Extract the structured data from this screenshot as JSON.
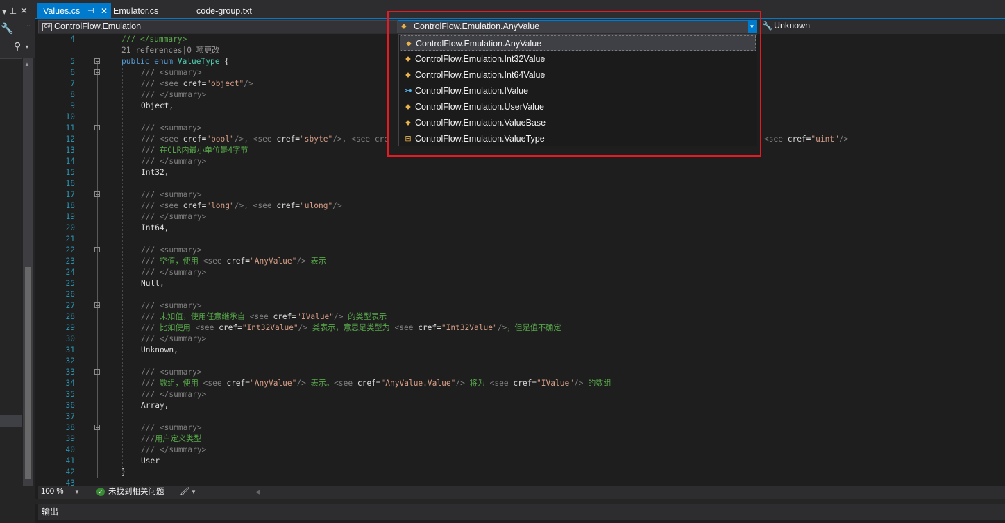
{
  "tabs": {
    "values": {
      "label": "Values.cs",
      "pin": "⊣",
      "close": "✕"
    },
    "emulator": {
      "label": "Emulator.cs"
    },
    "code_group": {
      "label": "code-group.txt"
    }
  },
  "navbar": {
    "namespace": "ControlFlow.Emulation",
    "type": "ControlFlow.Emulation.AnyValue",
    "member": "Unknown",
    "cs_icon": "C#"
  },
  "dropdown": {
    "items": [
      {
        "label": "ControlFlow.Emulation.AnyValue",
        "icon": "class-icon"
      },
      {
        "label": "ControlFlow.Emulation.Int32Value",
        "icon": "class-icon"
      },
      {
        "label": "ControlFlow.Emulation.Int64Value",
        "icon": "class-icon"
      },
      {
        "label": "ControlFlow.Emulation.IValue",
        "icon": "interface-icon"
      },
      {
        "label": "ControlFlow.Emulation.UserValue",
        "icon": "class-icon"
      },
      {
        "label": "ControlFlow.Emulation.ValueBase",
        "icon": "class-icon"
      },
      {
        "label": "ControlFlow.Emulation.ValueType",
        "icon": "enum-icon"
      }
    ],
    "selected_index": 0
  },
  "code": {
    "lines": [
      {
        "n": "4",
        "indent": 1,
        "tokens": [
          [
            "c",
            "/// </summary>"
          ]
        ]
      },
      {
        "n": "",
        "indent": 1,
        "tokens": [
          [
            "ref",
            "21 references|0 项更改"
          ]
        ]
      },
      {
        "n": "5",
        "indent": 1,
        "fold": true,
        "tokens": [
          [
            "k",
            "public "
          ],
          [
            "k",
            "enum "
          ],
          [
            "cl",
            "ValueType"
          ],
          [
            "p",
            " {"
          ]
        ]
      },
      {
        "n": "6",
        "indent": 2,
        "fold": true,
        "tokens": [
          [
            "x",
            "/// <summary>"
          ]
        ]
      },
      {
        "n": "7",
        "indent": 2,
        "tokens": [
          [
            "x",
            "/// <see "
          ],
          [
            "p",
            "cref="
          ],
          [
            "q",
            "\"object\""
          ],
          [
            "x",
            "/>"
          ]
        ]
      },
      {
        "n": "8",
        "indent": 2,
        "tokens": [
          [
            "x",
            "/// </summary>"
          ]
        ]
      },
      {
        "n": "9",
        "indent": 2,
        "tokens": [
          [
            "p",
            "Object,"
          ]
        ]
      },
      {
        "n": "10",
        "indent": 2,
        "tokens": []
      },
      {
        "n": "11",
        "indent": 2,
        "fold": true,
        "tokens": [
          [
            "x",
            "/// <summary>"
          ]
        ]
      },
      {
        "n": "12",
        "indent": 2,
        "tokens": [
          [
            "x",
            "/// <see "
          ],
          [
            "p",
            "cref="
          ],
          [
            "q",
            "\"bool\""
          ],
          [
            "x",
            "/>, <see "
          ],
          [
            "p",
            "cref="
          ],
          [
            "q",
            "\"sbyte\""
          ],
          [
            "x",
            "/>, <see cre"
          ],
          [
            "pad",
            ""
          ],
          [
            "x",
            "<see "
          ],
          [
            "p",
            "cref="
          ],
          [
            "q",
            "\"uint\""
          ],
          [
            "x",
            "/>"
          ]
        ]
      },
      {
        "n": "13",
        "indent": 2,
        "tokens": [
          [
            "x",
            "/// "
          ],
          [
            "c",
            "在CLR内最小单位是4字节"
          ]
        ]
      },
      {
        "n": "14",
        "indent": 2,
        "tokens": [
          [
            "x",
            "/// </summary>"
          ]
        ]
      },
      {
        "n": "15",
        "indent": 2,
        "tokens": [
          [
            "p",
            "Int32,"
          ]
        ]
      },
      {
        "n": "16",
        "indent": 2,
        "tokens": []
      },
      {
        "n": "17",
        "indent": 2,
        "fold": true,
        "tokens": [
          [
            "x",
            "/// <summary>"
          ]
        ]
      },
      {
        "n": "18",
        "indent": 2,
        "tokens": [
          [
            "x",
            "/// <see "
          ],
          [
            "p",
            "cref="
          ],
          [
            "q",
            "\"long\""
          ],
          [
            "x",
            "/>, <see "
          ],
          [
            "p",
            "cref="
          ],
          [
            "q",
            "\"ulong\""
          ],
          [
            "x",
            "/>"
          ]
        ]
      },
      {
        "n": "19",
        "indent": 2,
        "tokens": [
          [
            "x",
            "/// </summary>"
          ]
        ]
      },
      {
        "n": "20",
        "indent": 2,
        "tokens": [
          [
            "p",
            "Int64,"
          ]
        ]
      },
      {
        "n": "21",
        "indent": 2,
        "tokens": []
      },
      {
        "n": "22",
        "indent": 2,
        "fold": true,
        "tokens": [
          [
            "x",
            "/// <summary>"
          ]
        ]
      },
      {
        "n": "23",
        "indent": 2,
        "tokens": [
          [
            "x",
            "/// "
          ],
          [
            "c",
            "空值，使用 "
          ],
          [
            "x",
            "<see "
          ],
          [
            "p",
            "cref="
          ],
          [
            "q",
            "\"AnyValue\""
          ],
          [
            "x",
            "/> "
          ],
          [
            "c",
            "表示"
          ]
        ]
      },
      {
        "n": "24",
        "indent": 2,
        "tokens": [
          [
            "x",
            "/// </summary>"
          ]
        ]
      },
      {
        "n": "25",
        "indent": 2,
        "tokens": [
          [
            "p",
            "Null,"
          ]
        ]
      },
      {
        "n": "26",
        "indent": 2,
        "tokens": []
      },
      {
        "n": "27",
        "indent": 2,
        "fold": true,
        "tokens": [
          [
            "x",
            "/// <summary>"
          ]
        ]
      },
      {
        "n": "28",
        "indent": 2,
        "tokens": [
          [
            "x",
            "/// "
          ],
          [
            "c",
            "未知值，使用任意继承自 "
          ],
          [
            "x",
            "<see "
          ],
          [
            "p",
            "cref="
          ],
          [
            "q",
            "\"IValue\""
          ],
          [
            "x",
            "/> "
          ],
          [
            "c",
            "的类型表示"
          ]
        ]
      },
      {
        "n": "29",
        "indent": 2,
        "tokens": [
          [
            "x",
            "/// "
          ],
          [
            "c",
            "比如使用 "
          ],
          [
            "x",
            "<see "
          ],
          [
            "p",
            "cref="
          ],
          [
            "q",
            "\"Int32Value\""
          ],
          [
            "x",
            "/> "
          ],
          [
            "c",
            "类表示，意思是类型为 "
          ],
          [
            "x",
            "<see "
          ],
          [
            "p",
            "cref="
          ],
          [
            "q",
            "\"Int32Value\""
          ],
          [
            "x",
            "/>"
          ],
          [
            "c",
            "，但是值不确定"
          ]
        ]
      },
      {
        "n": "30",
        "indent": 2,
        "tokens": [
          [
            "x",
            "/// </summary>"
          ]
        ]
      },
      {
        "n": "31",
        "indent": 2,
        "tokens": [
          [
            "p",
            "Unknown,"
          ]
        ]
      },
      {
        "n": "32",
        "indent": 2,
        "tokens": []
      },
      {
        "n": "33",
        "indent": 2,
        "fold": true,
        "tokens": [
          [
            "x",
            "/// <summary>"
          ]
        ]
      },
      {
        "n": "34",
        "indent": 2,
        "tokens": [
          [
            "x",
            "/// "
          ],
          [
            "c",
            "数组，使用 "
          ],
          [
            "x",
            "<see "
          ],
          [
            "p",
            "cref="
          ],
          [
            "q",
            "\"AnyValue\""
          ],
          [
            "x",
            "/> "
          ],
          [
            "c",
            "表示。"
          ],
          [
            "x",
            "<see "
          ],
          [
            "p",
            "cref="
          ],
          [
            "q",
            "\"AnyValue.Value\""
          ],
          [
            "x",
            "/> "
          ],
          [
            "c",
            "将为 "
          ],
          [
            "x",
            "<see "
          ],
          [
            "p",
            "cref="
          ],
          [
            "q",
            "\"IValue\""
          ],
          [
            "x",
            "/> "
          ],
          [
            "c",
            "的数组"
          ]
        ]
      },
      {
        "n": "35",
        "indent": 2,
        "tokens": [
          [
            "x",
            "/// </summary>"
          ]
        ]
      },
      {
        "n": "36",
        "indent": 2,
        "tokens": [
          [
            "p",
            "Array,"
          ]
        ]
      },
      {
        "n": "37",
        "indent": 2,
        "tokens": []
      },
      {
        "n": "38",
        "indent": 2,
        "fold": true,
        "tokens": [
          [
            "x",
            "/// <summary>"
          ]
        ]
      },
      {
        "n": "39",
        "indent": 2,
        "tokens": [
          [
            "x",
            "///"
          ],
          [
            "c",
            "用户定义类型"
          ]
        ]
      },
      {
        "n": "40",
        "indent": 2,
        "tokens": [
          [
            "x",
            "/// </summary>"
          ]
        ]
      },
      {
        "n": "41",
        "indent": 2,
        "tokens": [
          [
            "p",
            "User"
          ]
        ]
      },
      {
        "n": "42",
        "indent": 1,
        "tokens": [
          [
            "p",
            "}"
          ]
        ]
      },
      {
        "n": "43",
        "indent": 1,
        "tokens": []
      }
    ]
  },
  "status": {
    "zoom": "100 %",
    "problems": "未找到相关问题",
    "problems_icon": "✓"
  },
  "output": {
    "title": "输出"
  }
}
